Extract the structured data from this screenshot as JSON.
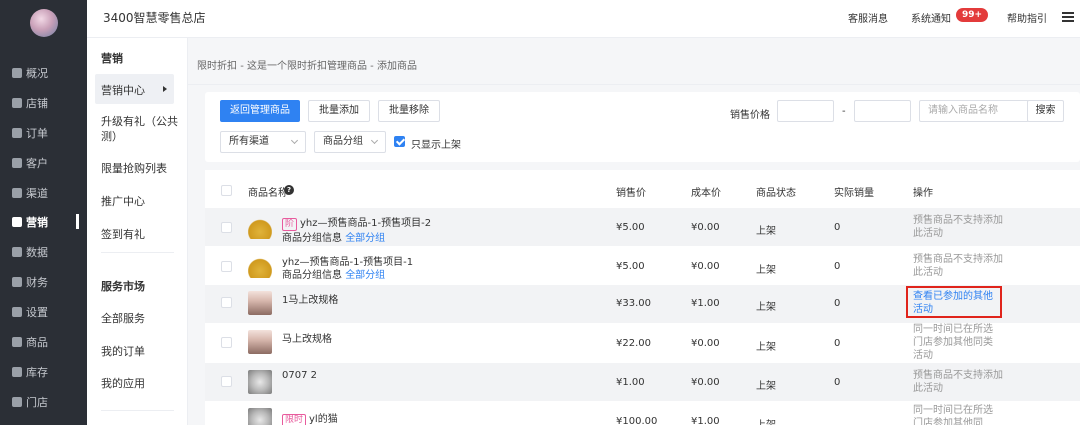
{
  "app": {
    "shop_name": "3400智慧零售总店",
    "top_links": {
      "service": "客服消息",
      "notify": "系统通知",
      "notify_badge": "99+",
      "guide": "帮助指引"
    }
  },
  "main_nav": [
    {
      "label": "概况",
      "icon": "overview-icon"
    },
    {
      "label": "店铺",
      "icon": "store-icon"
    },
    {
      "label": "订单",
      "icon": "order-icon"
    },
    {
      "label": "客户",
      "icon": "customer-icon"
    },
    {
      "label": "渠道",
      "icon": "channel-icon"
    },
    {
      "label": "营销",
      "icon": "marketing-icon",
      "active": true
    },
    {
      "label": "数据",
      "icon": "data-icon"
    },
    {
      "label": "财务",
      "icon": "finance-icon"
    },
    {
      "label": "设置",
      "icon": "settings-icon"
    },
    {
      "label": "商品",
      "icon": "goods-icon"
    },
    {
      "label": "库存",
      "icon": "inventory-icon"
    },
    {
      "label": "门店",
      "icon": "shop-icon"
    }
  ],
  "sub_nav": {
    "title": "营销",
    "items": [
      "营销中心",
      "升级有礼（公共测）",
      "限量抢购列表",
      "推广中心",
      "签到有礼"
    ],
    "section2_title": "服务市场",
    "section2_items": [
      "全部服务",
      "我的订单",
      "我的应用"
    ]
  },
  "breadcrumb": [
    "限时折扣",
    "这是一个限时折扣管理商品",
    "添加商品"
  ],
  "toolbar": {
    "back_button": "返回管理商品",
    "batch_add": "批量添加",
    "batch_remove": "批量移除",
    "price_label": "销售价格",
    "price_sep": "-",
    "search_placeholder": "请输入商品名称",
    "search_button": "搜索",
    "channel_select": "所有渠道",
    "group_select": "商品分组",
    "only_on_shelf": "只显示上架"
  },
  "table": {
    "headers": [
      "商品名称",
      "销售价",
      "成本价",
      "商品状态",
      "实际销量",
      "操作"
    ],
    "rows": [
      {
        "tag": "阶",
        "name": "yhz—预售商品-1-预售项目-2",
        "group_label": "商品分组信息",
        "group_value": "全部分组",
        "price": "¥5.00",
        "cost": "¥0.00",
        "status": "上架",
        "sales": "0",
        "op": "预售商品不支持添加此活动",
        "op_is_link": false
      },
      {
        "tag": "",
        "name": "yhz—预售商品-1-预售项目-1",
        "group_label": "商品分组信息",
        "group_value": "全部分组",
        "price": "¥5.00",
        "cost": "¥0.00",
        "status": "上架",
        "sales": "0",
        "op": "预售商品不支持添加此活动",
        "op_is_link": false
      },
      {
        "tag": "",
        "name": "1马上改规格",
        "group_label": "",
        "group_value": "",
        "price": "¥33.00",
        "cost": "¥1.00",
        "status": "上架",
        "sales": "0",
        "op": "查看已参加的其他活动",
        "op_is_link": true
      },
      {
        "tag": "",
        "name": "马上改规格",
        "group_label": "",
        "group_value": "",
        "price": "¥22.00",
        "cost": "¥0.00",
        "status": "上架",
        "sales": "0",
        "op": "同一时间已在所选门店参加其他同类活动",
        "op_is_link": false
      },
      {
        "tag": "",
        "name": "0707 2",
        "group_label": "",
        "group_value": "",
        "price": "¥1.00",
        "cost": "¥0.00",
        "status": "上架",
        "sales": "0",
        "op": "预售商品不支持添加此活动",
        "op_is_link": false
      },
      {
        "tag": "限时",
        "name": "yl的猫",
        "group_label": "",
        "group_value": "",
        "price": "¥100.00",
        "cost": "¥1.00",
        "status": "上架",
        "sales": "0",
        "op": "同一时间已在所选门店参加其他同",
        "op_is_link": false
      }
    ]
  }
}
